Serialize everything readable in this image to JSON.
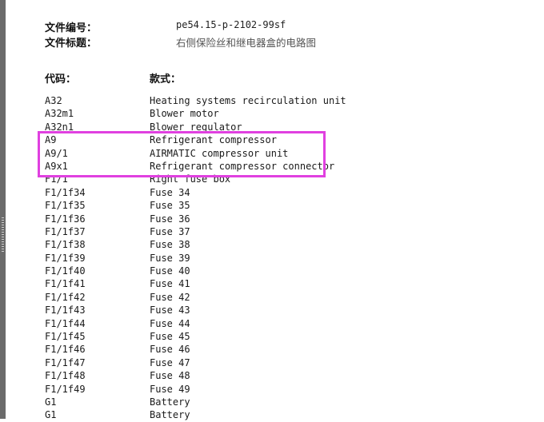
{
  "meta": {
    "doc_number_label": "文件编号：",
    "doc_number_value": "pe54.15-p-2102-99sf",
    "doc_title_label": "文件标题：",
    "doc_title_value": "右侧保险丝和继电器盒的电路图"
  },
  "columns": {
    "code": "代码：",
    "style": "款式："
  },
  "parts": [
    {
      "code": "A32",
      "desc": "Heating systems recirculation unit"
    },
    {
      "code": "A32m1",
      "desc": "Blower motor"
    },
    {
      "code": "A32n1",
      "desc": "Blower regulator"
    },
    {
      "code": "A9",
      "desc": "Refrigerant compressor"
    },
    {
      "code": "A9/1",
      "desc": "AIRMATIC compressor unit"
    },
    {
      "code": "A9x1",
      "desc": "Refrigerant compressor connector"
    },
    {
      "code": "F1/1",
      "desc": "Right fuse box"
    },
    {
      "code": "F1/1f34",
      "desc": "Fuse 34"
    },
    {
      "code": "F1/1f35",
      "desc": "Fuse 35"
    },
    {
      "code": "F1/1f36",
      "desc": "Fuse 36"
    },
    {
      "code": "F1/1f37",
      "desc": "Fuse 37"
    },
    {
      "code": "F1/1f38",
      "desc": "Fuse 38"
    },
    {
      "code": "F1/1f39",
      "desc": "Fuse 39"
    },
    {
      "code": "F1/1f40",
      "desc": "Fuse 40"
    },
    {
      "code": "F1/1f41",
      "desc": "Fuse 41"
    },
    {
      "code": "F1/1f42",
      "desc": "Fuse 42"
    },
    {
      "code": "F1/1f43",
      "desc": "Fuse 43"
    },
    {
      "code": "F1/1f44",
      "desc": "Fuse 44"
    },
    {
      "code": "F1/1f45",
      "desc": "Fuse 45"
    },
    {
      "code": "F1/1f46",
      "desc": "Fuse 46"
    },
    {
      "code": "F1/1f47",
      "desc": "Fuse 47"
    },
    {
      "code": "F1/1f48",
      "desc": "Fuse 48"
    },
    {
      "code": "F1/1f49",
      "desc": "Fuse 49"
    },
    {
      "code": "G1",
      "desc": "Battery"
    },
    {
      "code": "G1",
      "desc": "Battery"
    }
  ],
  "highlight_color": "#e040e0"
}
